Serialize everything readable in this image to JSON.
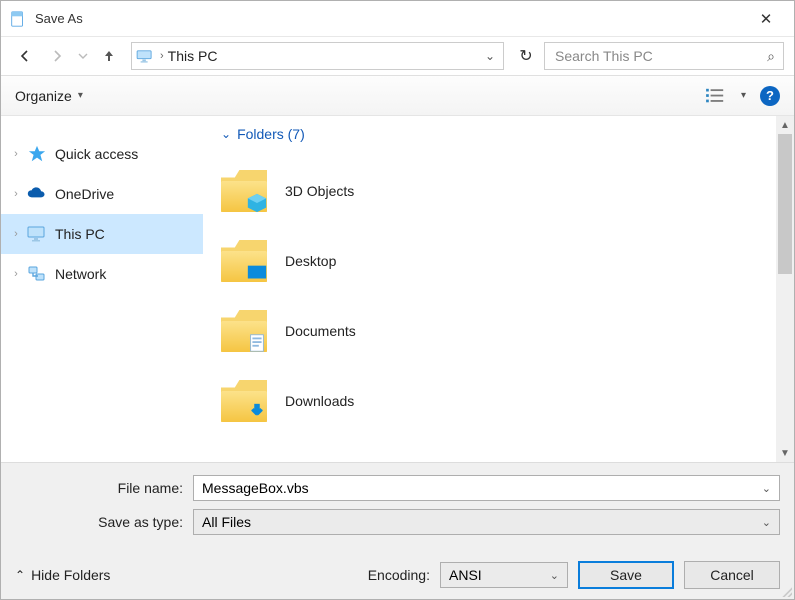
{
  "window": {
    "title": "Save As"
  },
  "breadcrumb": {
    "location": "This PC"
  },
  "search": {
    "placeholder": "Search This PC"
  },
  "toolbar": {
    "organize": "Organize"
  },
  "sidebar": {
    "items": [
      {
        "label": "Quick access"
      },
      {
        "label": "OneDrive"
      },
      {
        "label": "This PC"
      },
      {
        "label": "Network"
      }
    ]
  },
  "section": {
    "header": "Folders (7)"
  },
  "folders": [
    {
      "label": "3D Objects"
    },
    {
      "label": "Desktop"
    },
    {
      "label": "Documents"
    },
    {
      "label": "Downloads"
    }
  ],
  "filename": {
    "label": "File name:",
    "value": "MessageBox.vbs"
  },
  "savetype": {
    "label": "Save as type:",
    "value": "All Files"
  },
  "hide_folders": "Hide Folders",
  "encoding": {
    "label": "Encoding:",
    "value": "ANSI"
  },
  "buttons": {
    "save": "Save",
    "cancel": "Cancel"
  }
}
